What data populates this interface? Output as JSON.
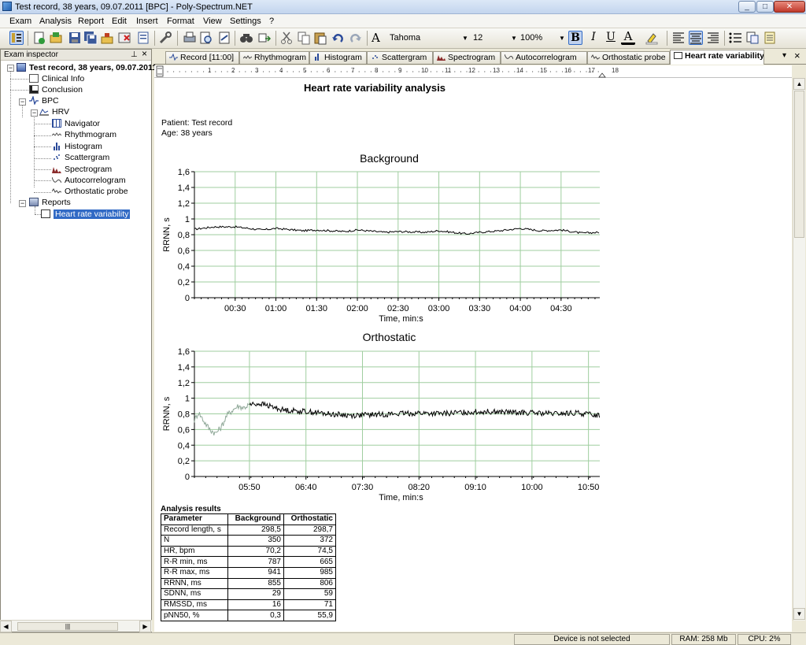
{
  "window": {
    "title": "Test record, 38 years, 09.07.2011 [BPC] - Poly-Spectrum.NET",
    "minimize": "_",
    "maximize": "□",
    "close": "✕"
  },
  "menu": [
    "Exam",
    "Analysis",
    "Report",
    "Edit",
    "Insert",
    "Format",
    "View",
    "Settings",
    "?"
  ],
  "toolbar": {
    "font_icon_label": "A",
    "font": "Tahoma",
    "size": "12",
    "zoom": "100%",
    "bold": "B",
    "italic": "I",
    "underline": "U",
    "color_letter": "A"
  },
  "inspector": {
    "title": "Exam inspector",
    "pin": "⊥",
    "close": "×",
    "root": "Test record, 38 years, 09.07.2011",
    "items": [
      {
        "label": "Clinical Info"
      },
      {
        "label": "Conclusion"
      },
      {
        "label": "BPC"
      },
      {
        "label": "HRV"
      },
      {
        "label": "Navigator"
      },
      {
        "label": "Rhythmogram"
      },
      {
        "label": "Histogram"
      },
      {
        "label": "Scattergram"
      },
      {
        "label": "Spectrogram"
      },
      {
        "label": "Autocorrelogram"
      },
      {
        "label": "Orthostatic probe"
      },
      {
        "label": "Reports"
      },
      {
        "label": "Heart rate variability"
      }
    ],
    "hscroll_thumb": "|||"
  },
  "tabs": [
    {
      "label": "Record [11:00]"
    },
    {
      "label": "Rhythmogram"
    },
    {
      "label": "Histogram"
    },
    {
      "label": "Scattergram"
    },
    {
      "label": "Spectrogram"
    },
    {
      "label": "Autocorrelogram"
    },
    {
      "label": "Orthostatic probe"
    },
    {
      "label": "Heart rate variability"
    }
  ],
  "tabs_controls": {
    "dropdown": "▾",
    "close": "×"
  },
  "ruler": [
    "1",
    "2",
    "3",
    "4",
    "5",
    "6",
    "7",
    "8",
    "9",
    "10",
    "11",
    "12",
    "13",
    "14",
    "15",
    "16",
    "17",
    "18"
  ],
  "report": {
    "title": "Heart rate variability analysis",
    "patient": "Patient: Test record",
    "age": "Age: 38 years"
  },
  "chart_data": [
    {
      "type": "line",
      "title": "Background",
      "xlabel": "Time, min:s",
      "ylabel": "RRNN, s",
      "yticks": [
        "0",
        "0,2",
        "0,4",
        "0,6",
        "0,8",
        "1",
        "1,2",
        "1,4",
        "1,6"
      ],
      "xticks": [
        "00:30",
        "01:00",
        "01:30",
        "02:00",
        "02:30",
        "03:00",
        "03:30",
        "04:00",
        "04:30"
      ],
      "xlim": [
        0,
        298.5
      ],
      "ylim": [
        0,
        1.6
      ],
      "grid": true,
      "series": [
        {
          "x": [
            0,
            15,
            30,
            50,
            60,
            80,
            90,
            110,
            120,
            140,
            150,
            170,
            180,
            200,
            210,
            225,
            240,
            255,
            270,
            285,
            298.5
          ],
          "values": [
            0.87,
            0.9,
            0.9,
            0.86,
            0.88,
            0.85,
            0.86,
            0.84,
            0.86,
            0.83,
            0.84,
            0.83,
            0.85,
            0.81,
            0.83,
            0.85,
            0.88,
            0.85,
            0.86,
            0.82,
            0.83
          ]
        }
      ]
    },
    {
      "type": "line",
      "title": "Orthostatic",
      "xlabel": "Time, min:s",
      "ylabel": "RRNN, s",
      "yticks": [
        "0",
        "0,2",
        "0,4",
        "0,6",
        "0,8",
        "1",
        "1,2",
        "1,4",
        "1,6"
      ],
      "xticks": [
        "05:50",
        "06:40",
        "07:30",
        "08:20",
        "09:10",
        "10:00",
        "10:50"
      ],
      "xlim": [
        301.3,
        660
      ],
      "ylim": [
        0,
        1.6
      ],
      "grid": true,
      "series": [
        {
          "x": [
            301.3,
            305,
            310,
            315,
            320,
            325,
            330,
            335,
            340,
            345,
            350
          ],
          "values": [
            0.72,
            0.82,
            0.7,
            0.6,
            0.55,
            0.63,
            0.78,
            0.85,
            0.9,
            0.88,
            0.92
          ]
        },
        {
          "x": [
            350,
            360,
            380,
            400,
            420,
            440,
            460,
            480,
            500,
            520,
            540,
            560,
            580,
            600,
            620,
            640,
            660
          ],
          "values": [
            0.92,
            0.93,
            0.85,
            0.83,
            0.8,
            0.78,
            0.79,
            0.8,
            0.81,
            0.8,
            0.82,
            0.83,
            0.82,
            0.81,
            0.8,
            0.81,
            0.78
          ]
        }
      ]
    }
  ],
  "results": {
    "caption": "Analysis results",
    "headers": [
      "Parameter",
      "Background",
      "Orthostatic"
    ],
    "rows": [
      [
        "Record length, s",
        "298,5",
        "298,7"
      ],
      [
        "N",
        "350",
        "372"
      ],
      [
        "HR, bpm",
        "70,2",
        "74,5"
      ],
      [
        "R-R min, ms",
        "787",
        "665"
      ],
      [
        "R-R max, ms",
        "941",
        "985"
      ],
      [
        "RRNN, ms",
        "855",
        "806"
      ],
      [
        "SDNN, ms",
        "29",
        "59"
      ],
      [
        "RMSSD, ms",
        "16",
        "71"
      ],
      [
        "pNN50, %",
        "0,3",
        "55,9"
      ]
    ]
  },
  "status": {
    "device": "Device is not selected",
    "ram": "RAM: 258 Mb",
    "cpu": "CPU: 2%"
  },
  "colors": {
    "plot_grid": "#9fce9f",
    "line": "#000000",
    "line_transient": "#8fa898",
    "selection": "#316ac5"
  }
}
